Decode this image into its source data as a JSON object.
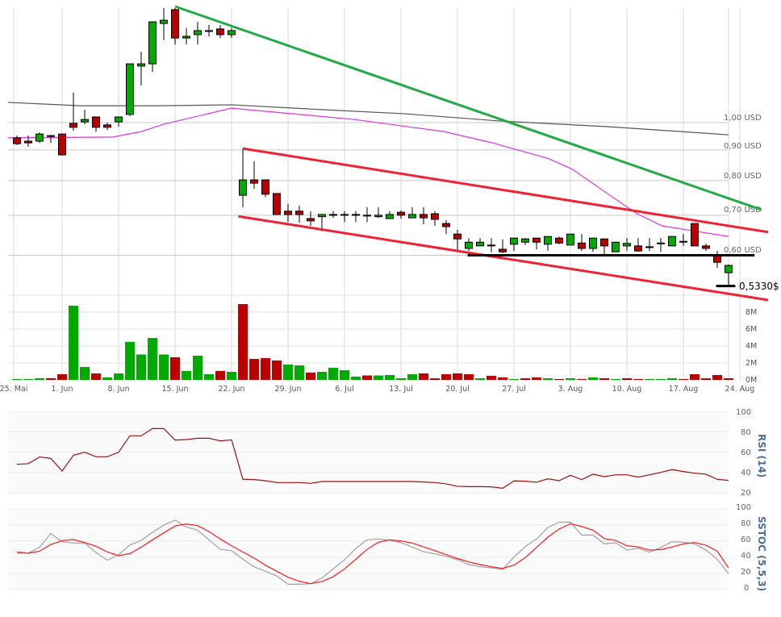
{
  "colors": {
    "up": "#00aa00",
    "down": "#bb0000",
    "trend_down": "#22aa44",
    "channel": "#ee2233",
    "support": "#000000",
    "ma_long": "#555555",
    "ma_short": "#dd33dd",
    "rsi": "#a01010",
    "stoch_k": "#a0a0a0",
    "stoch_d": "#ff1a1a",
    "panel_title": "#4a6d9a"
  },
  "x_ticks": [
    "25. Mai",
    "1. Jun",
    "8. Jun",
    "15. Jun",
    "22. Jun",
    "29. Jun",
    "6. Jul",
    "13. Jul",
    "20. Jul",
    "27. Jul",
    "3. Aug",
    "10. Aug",
    "17. Aug",
    "24. Aug"
  ],
  "chart_data": [
    {
      "type": "candlestick",
      "scale": "log",
      "grid": true,
      "y_ticks": [
        1.0,
        0.9,
        0.8,
        0.7,
        0.6
      ],
      "y_tick_labels": [
        "1,00 USD",
        "0,90 USD",
        "0,80 USD",
        "0,70 USD",
        "0,60 USD"
      ],
      "last_price_label": "0,5330$",
      "last_price": 0.533,
      "ohlc": [
        [
          0.943,
          0.951,
          0.917,
          0.922
        ],
        [
          0.931,
          0.951,
          0.911,
          0.925
        ],
        [
          0.931,
          0.963,
          0.925,
          0.957
        ],
        [
          0.951,
          0.954,
          0.925,
          0.951
        ],
        [
          0.957,
          0.957,
          0.883,
          0.883
        ],
        [
          0.997,
          1.122,
          0.969,
          0.982
        ],
        [
          1.003,
          1.051,
          0.994,
          1.012
        ],
        [
          1.022,
          1.022,
          0.966,
          0.982
        ],
        [
          0.991,
          1.0,
          0.972,
          0.982
        ],
        [
          1.003,
          1.022,
          0.985,
          1.022
        ],
        [
          1.032,
          1.254,
          1.025,
          1.254
        ],
        [
          1.243,
          1.314,
          1.154,
          1.254
        ],
        [
          1.254,
          1.474,
          1.216,
          1.474
        ],
        [
          1.465,
          1.554,
          1.373,
          1.483
        ],
        [
          1.545,
          1.554,
          1.351,
          1.385
        ],
        [
          1.385,
          1.44,
          1.351,
          1.394
        ],
        [
          1.403,
          1.474,
          1.351,
          1.425
        ],
        [
          1.425,
          1.456,
          1.394,
          1.425
        ],
        [
          1.434,
          1.456,
          1.385,
          1.403
        ],
        [
          1.403,
          1.44,
          1.385,
          1.425
        ],
        [
          0.756,
          0.905,
          0.722,
          0.802
        ],
        [
          0.802,
          0.862,
          0.775,
          0.792
        ],
        [
          0.802,
          0.802,
          0.751,
          0.759
        ],
        [
          0.761,
          0.761,
          0.702,
          0.702
        ],
        [
          0.711,
          0.731,
          0.682,
          0.702
        ],
        [
          0.711,
          0.726,
          0.68,
          0.702
        ],
        [
          0.691,
          0.711,
          0.672,
          0.685
        ],
        [
          0.696,
          0.702,
          0.658,
          0.702
        ],
        [
          0.702,
          0.711,
          0.693,
          0.702
        ],
        [
          0.702,
          0.711,
          0.682,
          0.702
        ],
        [
          0.702,
          0.711,
          0.682,
          0.702
        ],
        [
          0.7,
          0.722,
          0.682,
          0.7
        ],
        [
          0.696,
          0.722,
          0.693,
          0.7
        ],
        [
          0.691,
          0.711,
          0.691,
          0.702
        ],
        [
          0.708,
          0.713,
          0.691,
          0.7
        ],
        [
          0.693,
          0.722,
          0.693,
          0.702
        ],
        [
          0.702,
          0.722,
          0.676,
          0.693
        ],
        [
          0.704,
          0.711,
          0.672,
          0.689
        ],
        [
          0.678,
          0.687,
          0.651,
          0.67
        ],
        [
          0.651,
          0.662,
          0.61,
          0.639
        ],
        [
          0.616,
          0.641,
          0.61,
          0.631
        ],
        [
          0.622,
          0.641,
          0.622,
          0.631
        ],
        [
          0.624,
          0.641,
          0.607,
          0.624
        ],
        [
          0.614,
          0.638,
          0.605,
          0.608
        ],
        [
          0.626,
          0.641,
          0.61,
          0.641
        ],
        [
          0.631,
          0.641,
          0.624,
          0.639
        ],
        [
          0.641,
          0.641,
          0.614,
          0.631
        ],
        [
          0.626,
          0.645,
          0.61,
          0.645
        ],
        [
          0.641,
          0.645,
          0.626,
          0.629
        ],
        [
          0.624,
          0.651,
          0.624,
          0.651
        ],
        [
          0.629,
          0.651,
          0.61,
          0.616
        ],
        [
          0.616,
          0.641,
          0.608,
          0.641
        ],
        [
          0.639,
          0.639,
          0.601,
          0.622
        ],
        [
          0.608,
          0.631,
          0.608,
          0.631
        ],
        [
          0.622,
          0.641,
          0.61,
          0.628
        ],
        [
          0.622,
          0.641,
          0.608,
          0.61
        ],
        [
          0.62,
          0.641,
          0.61,
          0.62
        ],
        [
          0.629,
          0.641,
          0.608,
          0.629
        ],
        [
          0.622,
          0.645,
          0.622,
          0.645
        ],
        [
          0.633,
          0.651,
          0.622,
          0.633
        ],
        [
          0.678,
          0.678,
          0.622,
          0.622
        ],
        [
          0.622,
          0.628,
          0.61,
          0.616
        ],
        [
          0.599,
          0.61,
          0.572,
          0.584
        ],
        [
          0.561,
          0.579,
          0.534,
          0.577
        ]
      ],
      "moving_average_long": [
        [
          -0.8,
          1.081
        ],
        [
          5.6,
          1.067
        ],
        [
          12.8,
          1.067
        ],
        [
          19,
          1.071
        ],
        [
          27.1,
          1.051
        ],
        [
          34.2,
          1.035
        ],
        [
          42.8,
          1.006
        ],
        [
          52.1,
          0.985
        ],
        [
          63,
          0.954
        ]
      ],
      "moving_average_short": [
        [
          -0.8,
          0.943
        ],
        [
          8.5,
          0.946
        ],
        [
          11,
          0.966
        ],
        [
          13,
          0.994
        ],
        [
          19,
          1.057
        ],
        [
          29.9,
          1.012
        ],
        [
          37.8,
          0.966
        ],
        [
          42.1,
          0.925
        ],
        [
          47.1,
          0.87
        ],
        [
          49.2,
          0.835
        ],
        [
          52.8,
          0.749
        ],
        [
          54.9,
          0.704
        ],
        [
          57.1,
          0.672
        ],
        [
          59.9,
          0.659
        ],
        [
          63,
          0.645
        ]
      ],
      "trendlines": [
        {
          "kind": "downtrend",
          "points": [
            [
              14,
              1.564
            ],
            [
              65.9,
              0.715
            ]
          ]
        },
        {
          "kind": "channel-upper",
          "points": [
            [
              20,
              0.905
            ],
            [
              66.5,
              0.656
            ]
          ]
        },
        {
          "kind": "channel-lower",
          "points": [
            [
              19.6,
              0.697
            ],
            [
              66.5,
              0.505
            ]
          ]
        },
        {
          "kind": "support",
          "points": [
            [
              39.9,
              0.6
            ],
            [
              65.3,
              0.6
            ]
          ]
        },
        {
          "kind": "last-price",
          "points": [
            [
              61.9,
              0.533
            ],
            [
              63.6,
              0.533
            ]
          ]
        }
      ]
    },
    {
      "type": "bar",
      "y_ticks": [
        8,
        6,
        4,
        2,
        0
      ],
      "y_tick_labels": [
        "8M",
        "6M",
        "4M",
        "2M",
        "0M"
      ],
      "unit": "M",
      "values": [
        0.1,
        0.1,
        0.2,
        0.2,
        0.67,
        8.76,
        1.52,
        0.76,
        0.29,
        0.76,
        4.5,
        3.0,
        4.95,
        3.0,
        2.67,
        1.05,
        2.86,
        0.67,
        1.05,
        0.95,
        8.95,
        2.48,
        2.57,
        2.29,
        1.81,
        1.71,
        0.86,
        0.95,
        1.43,
        1.14,
        0.38,
        0.52,
        0.52,
        0.57,
        0.19,
        0.67,
        0.76,
        0.19,
        0.67,
        0.76,
        0.67,
        0.19,
        0.48,
        0.29,
        0.1,
        0.19,
        0.29,
        0.19,
        0.1,
        0.19,
        0.1,
        0.29,
        0.19,
        0.1,
        0.19,
        0.1,
        0.1,
        0.1,
        0.19,
        0.1,
        0.67,
        0.19,
        0.57,
        0.19
      ],
      "direction": "gggrrggrggggggrgggrgrrrrggrggggrggggrrrrrgrrgrrgrgrgrgrrgggrrrrr"
    },
    {
      "type": "line",
      "title": "RSI (14)",
      "ylim": [
        20,
        100
      ],
      "y_tick_labels": [
        "100",
        "80",
        "60",
        "40",
        "20"
      ],
      "values": [
        48.2,
        48.8,
        55.4,
        54,
        41.6,
        57,
        60.1,
        55.6,
        55.6,
        60.1,
        76.2,
        76.2,
        83.3,
        83.3,
        72,
        72.5,
        73.8,
        73.8,
        71.2,
        72.2,
        33.5,
        33.2,
        32.1,
        30.3,
        30.3,
        30.3,
        29.5,
        31.3,
        31.3,
        31.3,
        31.3,
        31.3,
        31.3,
        31.3,
        31.3,
        31.3,
        30.8,
        30.3,
        29,
        26.6,
        26.3,
        26.3,
        26.1,
        24.7,
        31.9,
        31.6,
        30.6,
        34,
        32.1,
        37.4,
        33.2,
        38.5,
        36.1,
        37.9,
        37.9,
        35.6,
        37.9,
        40.3,
        43,
        41.1,
        39.5,
        38.5,
        33.5,
        32.4
      ]
    },
    {
      "type": "line",
      "title": "SSTOC (5,5,3)",
      "ylim": [
        0,
        100
      ],
      "y_tick_labels": [
        "100",
        "80",
        "60",
        "40",
        "20",
        "0"
      ],
      "series": [
        {
          "values": [
            44.9,
            45.2,
            52.2,
            69.4,
            59.1,
            57.5,
            57.5,
            45.8,
            36.2,
            43.2,
            55.1,
            60.8,
            70.8,
            79.7,
            85.7,
            77.4,
            73.4,
            61.5,
            49.8,
            48.2,
            37.5,
            28.2,
            22.6,
            16.9,
            6.6,
            6.6,
            7.3,
            14.3,
            25.6,
            36.9,
            50.8,
            61.5,
            62.5,
            60.8,
            58.1,
            52.5,
            46.8,
            44.2,
            40.9,
            36.9,
            30.9,
            28.2,
            26.9,
            24.9,
            40.2,
            53.2,
            62.5,
            76.7,
            83.4,
            83.4,
            67.4,
            67.4,
            56.5,
            57.8,
            48.8,
            51.2,
            46.2,
            52.2,
            59.1,
            58.5,
            56.5,
            48.8,
            37.5,
            19.6
          ]
        },
        {
          "values": [
            46.5,
            44.9,
            47.5,
            55.8,
            60.5,
            61.8,
            58.1,
            53.5,
            46.5,
            41.9,
            44.5,
            52.5,
            61.5,
            70.1,
            78.7,
            81.1,
            79.1,
            71.8,
            62.5,
            54.2,
            46.5,
            38.9,
            30.2,
            22.6,
            15.3,
            10.3,
            7.3,
            10,
            15.9,
            25.6,
            37.5,
            49.8,
            58.5,
            61.5,
            60.1,
            57.5,
            52.8,
            48.2,
            43.2,
            38.5,
            34.2,
            30.9,
            28.2,
            26.2,
            30.2,
            39.5,
            52.2,
            64.8,
            74.8,
            81.4,
            78.1,
            73.4,
            63.1,
            60.8,
            54.2,
            52.8,
            48.8,
            49.5,
            52.5,
            56.5,
            58.1,
            54.8,
            47.5,
            26.6
          ]
        }
      ]
    }
  ]
}
